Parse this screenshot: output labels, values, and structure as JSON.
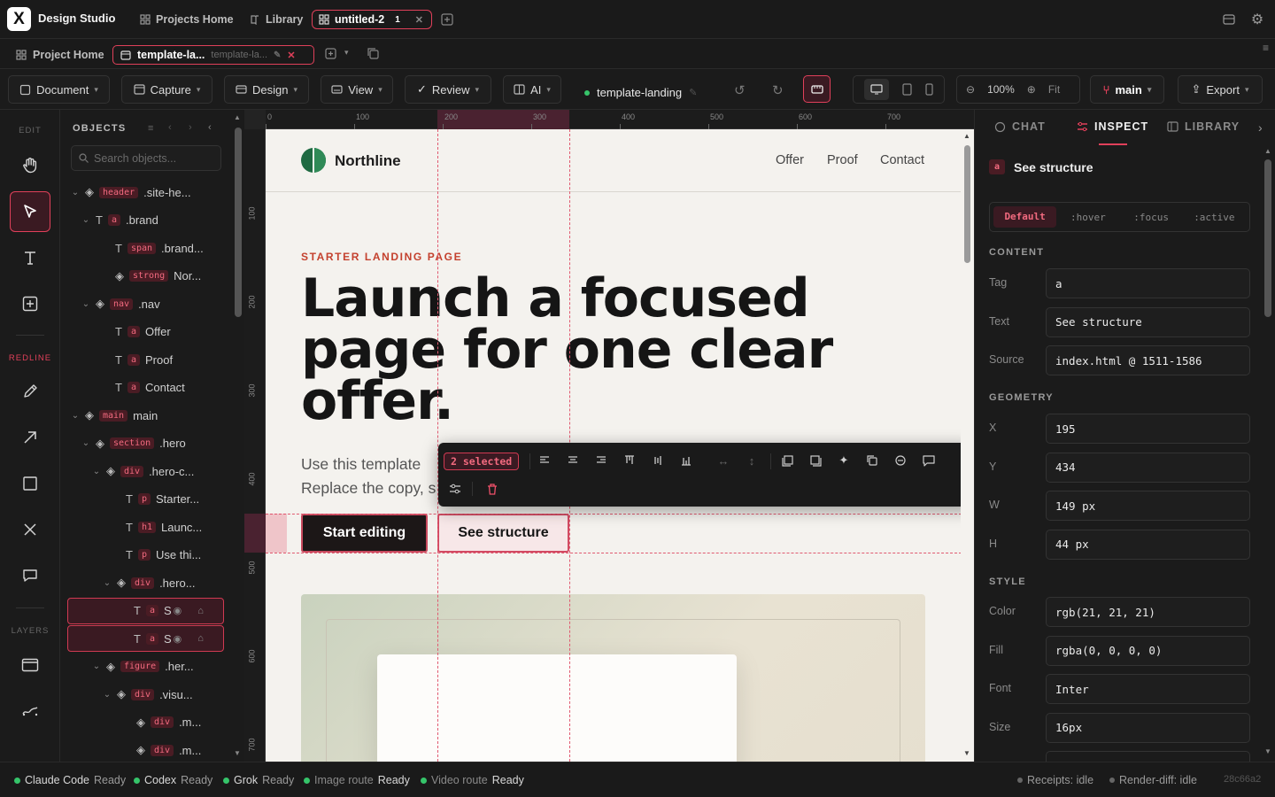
{
  "app": {
    "logo": "X",
    "name": "Design Studio"
  },
  "top_tabs": [
    {
      "label": "Projects Home",
      "icon": "grid-icon"
    },
    {
      "label": "Library",
      "icon": "book-icon"
    },
    {
      "label": "untitled-2",
      "icon": "grid-icon",
      "badge": "1",
      "active": true
    }
  ],
  "file_tabs": [
    {
      "label": "Project Home",
      "icon": "grid-icon"
    },
    {
      "label": "template-la...",
      "sub": "template-la...",
      "icon": "window-icon",
      "active": true
    }
  ],
  "toolbar": {
    "menus": [
      "Document",
      "Capture",
      "Design",
      "View",
      "Review",
      "AI"
    ],
    "doc_name": "template-landing",
    "zoom": "100%",
    "fit": "Fit",
    "branch": "main",
    "export": "Export"
  },
  "rail": {
    "edit_label": "EDIT",
    "redline_label": "REDLINE",
    "layers_label": "LAYERS"
  },
  "objects": {
    "title": "OBJECTS",
    "search_placeholder": "Search objects...",
    "nodes": [
      {
        "tag": "header",
        "label": ".site-he..."
      },
      {
        "tag": "a",
        "label": ".brand"
      },
      {
        "tag": "span",
        "label": ".brand..."
      },
      {
        "tag": "strong",
        "label": "Nor..."
      },
      {
        "tag": "nav",
        "label": ".nav"
      },
      {
        "tag": "a",
        "label": "Offer"
      },
      {
        "tag": "a",
        "label": "Proof"
      },
      {
        "tag": "a",
        "label": "Contact"
      },
      {
        "tag": "main",
        "label": "main"
      },
      {
        "tag": "section",
        "label": ".hero"
      },
      {
        "tag": "div",
        "label": ".hero-c..."
      },
      {
        "tag": "p",
        "label": "Starter..."
      },
      {
        "tag": "h1",
        "label": "Launc..."
      },
      {
        "tag": "p",
        "label": "Use thi..."
      },
      {
        "tag": "div",
        "label": ".hero..."
      },
      {
        "tag": "a",
        "label": "S"
      },
      {
        "tag": "a",
        "label": "S"
      },
      {
        "tag": "figure",
        "label": ".her..."
      },
      {
        "tag": "div",
        "label": ".visu..."
      },
      {
        "tag": "div",
        "label": ".m..."
      },
      {
        "tag": "div",
        "label": ".m..."
      }
    ]
  },
  "rulers": {
    "top": [
      "0",
      "100",
      "200",
      "300",
      "400",
      "500",
      "600",
      "700"
    ],
    "left": [
      "100",
      "200",
      "300",
      "400",
      "500",
      "600",
      "700"
    ]
  },
  "page": {
    "brand": "Northline",
    "nav": [
      "Offer",
      "Proof",
      "Contact"
    ],
    "eyebrow": "STARTER LANDING PAGE",
    "headline": "Launch a focused page for one clear offer.",
    "lead": "Use this template Replace the copy, s",
    "cta_primary": "Start editing",
    "cta_secondary": "See structure",
    "selected_caption": "selected"
  },
  "floating_toolbar": {
    "count_label": "2 selected"
  },
  "inspector": {
    "tabs": [
      "CHAT",
      "INSPECT",
      "LIBRARY"
    ],
    "selection": {
      "tag": "a",
      "name": "See structure"
    },
    "states": [
      "Default",
      ":hover",
      ":focus",
      ":active"
    ],
    "content_title": "CONTENT",
    "content": [
      {
        "label": "Tag",
        "value": "a"
      },
      {
        "label": "Text",
        "value": "See structure"
      },
      {
        "label": "Source",
        "value": "index.html @ 1511-1586"
      }
    ],
    "geometry_title": "GEOMETRY",
    "geometry": [
      {
        "label": "X",
        "value": "195"
      },
      {
        "label": "Y",
        "value": "434"
      },
      {
        "label": "W",
        "value": "149 px"
      },
      {
        "label": "H",
        "value": "44 px"
      }
    ],
    "style_title": "STYLE",
    "style": [
      {
        "label": "Color",
        "value": "rgb(21, 21, 21)"
      },
      {
        "label": "Fill",
        "value": "rgba(0, 0, 0, 0)"
      },
      {
        "label": "Font",
        "value": "Inter"
      },
      {
        "label": "Size",
        "value": "16px"
      }
    ]
  },
  "status": {
    "items": [
      {
        "name": "Claude Code",
        "state": "Ready"
      },
      {
        "name": "Codex",
        "state": "Ready"
      },
      {
        "name": "Grok",
        "state": "Ready"
      },
      {
        "name": "Image route",
        "state": "Ready"
      },
      {
        "name": "Video route",
        "state": "Ready"
      }
    ],
    "receipts": "Receipts: idle",
    "render_diff": "Render-diff: idle",
    "hash": "28c66a2"
  },
  "colors": {
    "accent": "#e0405a",
    "brand_green": "#1f6a42",
    "eyebrow": "#c4412e",
    "ready": "#35c46a"
  }
}
